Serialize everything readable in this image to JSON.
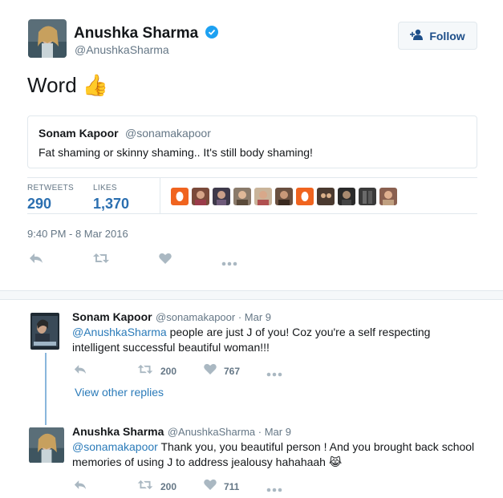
{
  "tweet": {
    "author_name": "Anushka Sharma",
    "author_handle": "@AnushkaSharma",
    "follow_label": "Follow",
    "text": "Word",
    "emoji": "👍",
    "quote": {
      "name": "Sonam Kapoor",
      "handle": "@sonamakapoor",
      "text": "Fat shaming or skinny shaming.. It's still body shaming!"
    },
    "retweets_label": "RETWEETS",
    "retweets": "290",
    "likes_label": "LIKES",
    "likes": "1,370",
    "timestamp": "9:40 PM - 8 Mar 2016"
  },
  "replies": [
    {
      "name": "Sonam Kapoor",
      "meta": "@sonamakapoor · Mar 9",
      "mention": "@AnushkaSharma",
      "text_line1": " people are just J of you! Coz you're a self respecting",
      "text_line2": "intelligent successful beautiful woman!!!",
      "retweets": "200",
      "likes": "767"
    },
    {
      "name": "Anushka Sharma",
      "meta": "@AnushkaSharma · Mar 9",
      "mention": "@sonamakapoor",
      "text_line1": " Thank you, you beautiful person ! And you brought back school",
      "text_line2": "memories of using J to address jealousy hahahaah",
      "emoji": "😹",
      "retweets": "200",
      "likes": "711"
    }
  ],
  "view_other_replies": "View other replies",
  "colors": {
    "link": "#2b7bb9",
    "stat": "#2b6fb0",
    "muted": "#657786",
    "icon": "#aab8c2",
    "thread": "#89b6dc"
  }
}
